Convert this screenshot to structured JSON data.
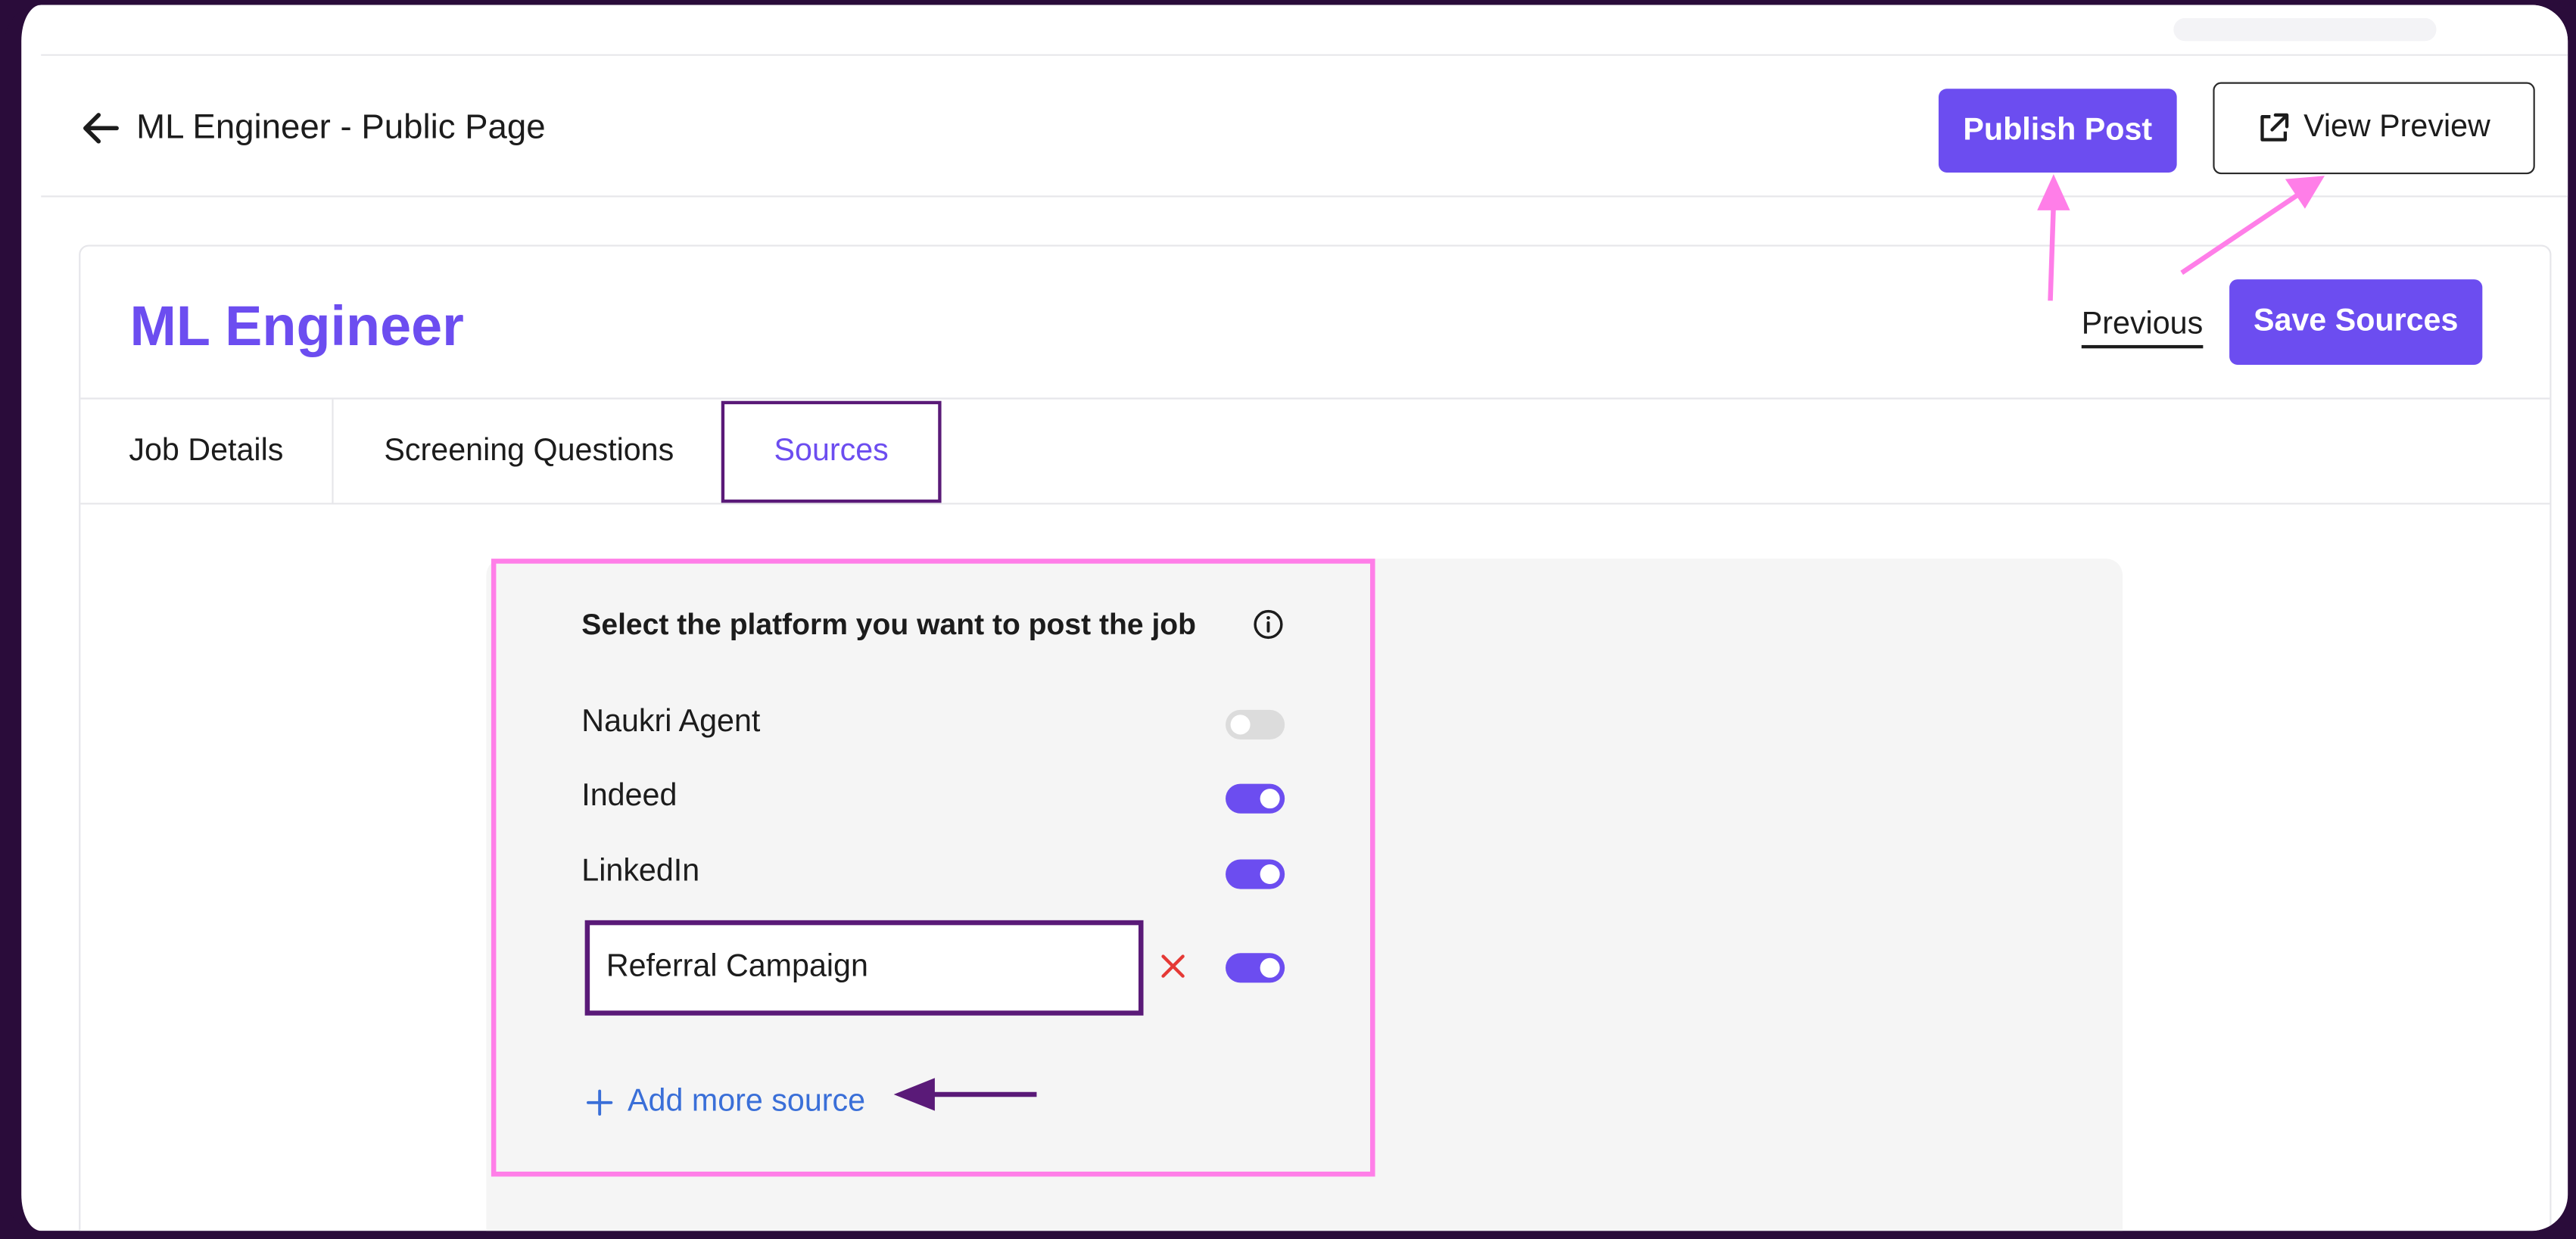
{
  "header": {
    "title": "ML Engineer - Public Page",
    "publish_label": "Publish Post",
    "preview_label": "View Preview"
  },
  "job": {
    "title": "ML Engineer",
    "previous_label": "Previous",
    "save_label": "Save Sources"
  },
  "tabs": [
    {
      "label": "Job Details",
      "active": false
    },
    {
      "label": "Screening Questions",
      "active": false
    },
    {
      "label": "Sources",
      "active": true
    }
  ],
  "sources": {
    "heading": "Select the platform you want to post the job",
    "items": [
      {
        "label": "Naukri Agent",
        "enabled": false
      },
      {
        "label": "Indeed",
        "enabled": true
      },
      {
        "label": "LinkedIn",
        "enabled": true
      }
    ],
    "custom_source_value": "Referral Campaign",
    "custom_source_enabled": true,
    "add_more_label": "Add more source"
  },
  "colors": {
    "accent": "#6c4df0",
    "highlight": "#ff7ee8",
    "outline": "#5a1a78",
    "link": "#3a6fd8",
    "danger": "#e53935"
  }
}
